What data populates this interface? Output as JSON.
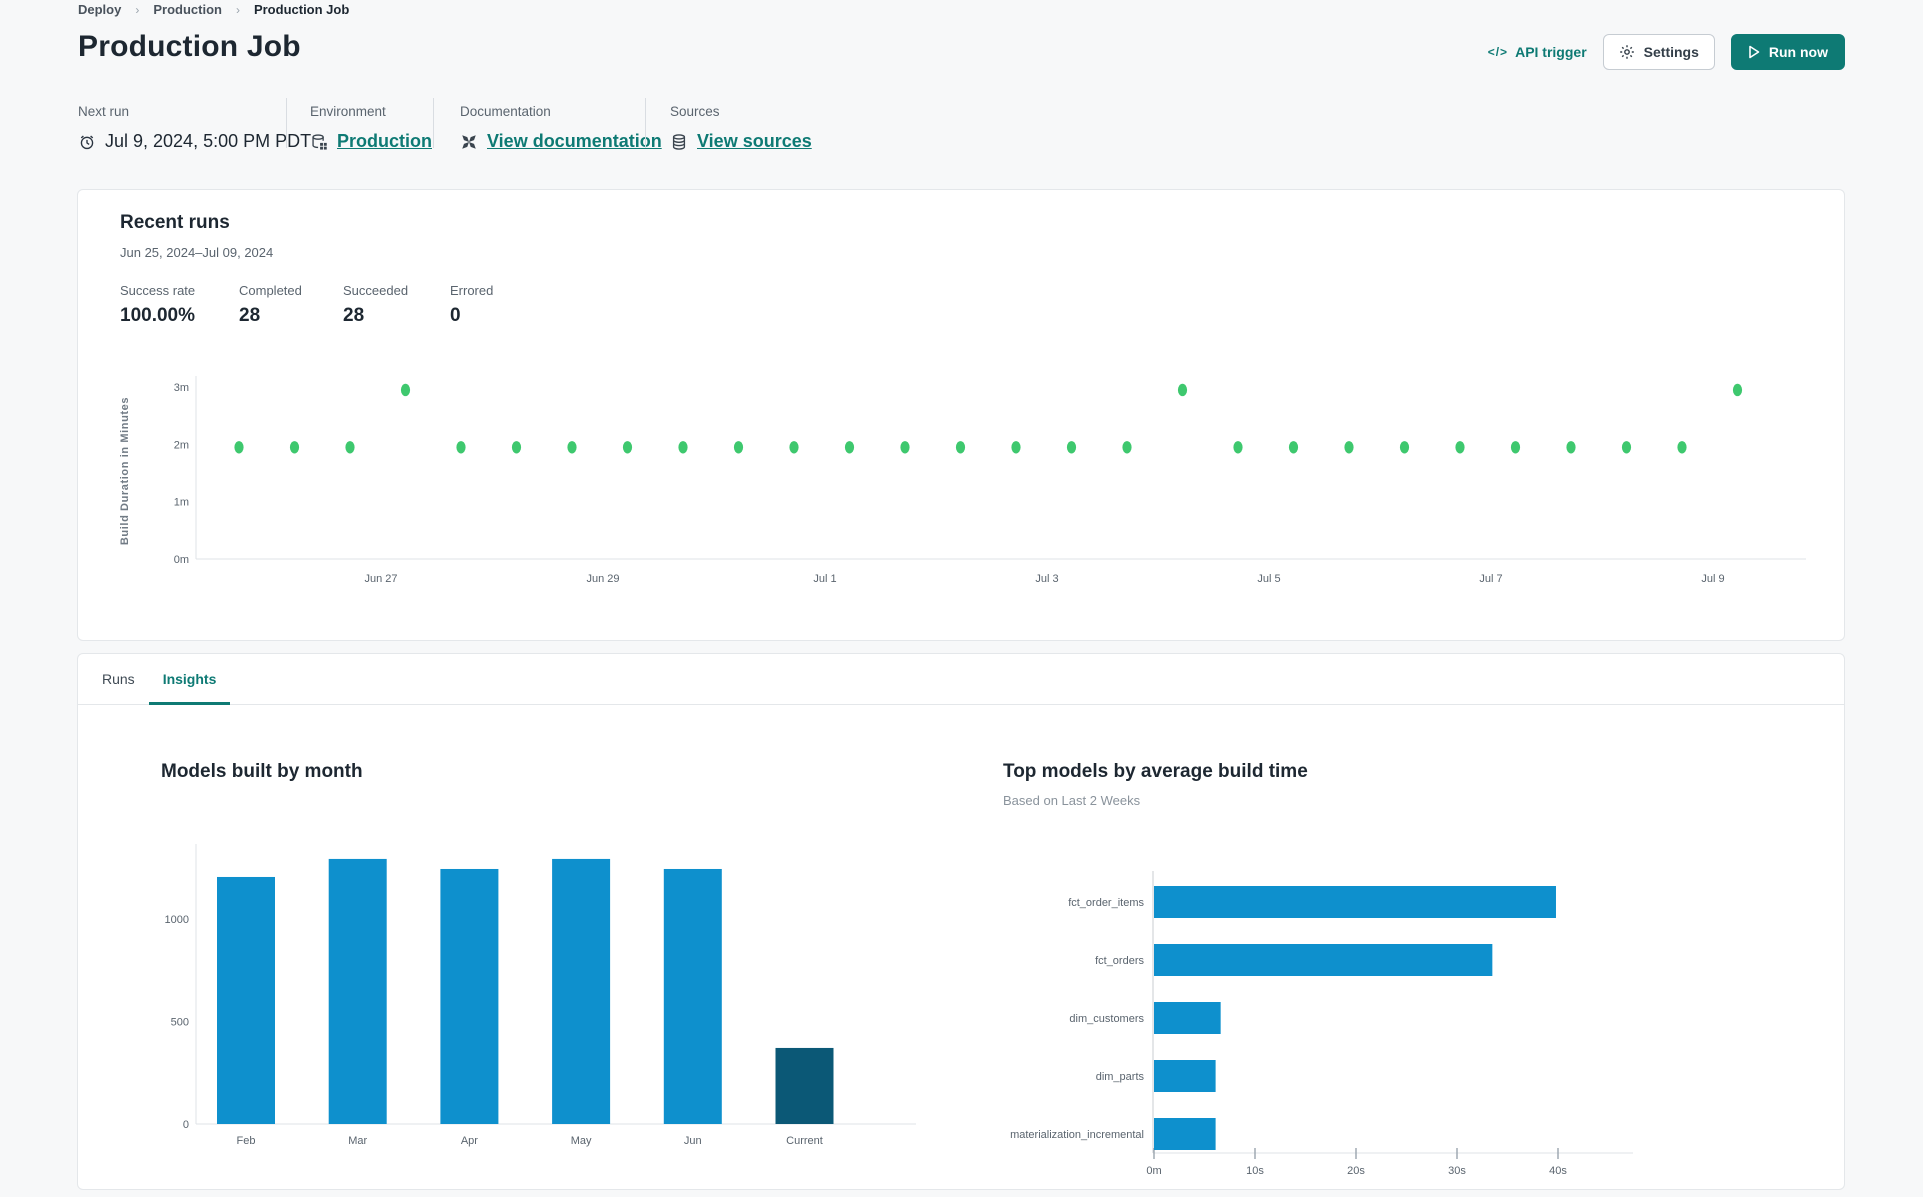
{
  "breadcrumb": {
    "items": [
      "Deploy",
      "Production",
      "Production Job"
    ]
  },
  "header": {
    "title": "Production Job",
    "api_trigger": {
      "label": "API trigger",
      "icon": "code-icon"
    },
    "settings": {
      "label": "Settings",
      "icon": "gear-icon"
    },
    "run_now": {
      "label": "Run now",
      "icon": "play-icon"
    }
  },
  "info_bar": {
    "next_run": {
      "label": "Next run",
      "value": "Jul 9, 2024, 5:00 PM PDT",
      "icon": "alarm-clock-icon"
    },
    "environment": {
      "label": "Environment",
      "value": "Production",
      "icon": "environment-database-icon"
    },
    "documentation": {
      "label": "Documentation",
      "value": "View documentation",
      "icon": "dbt-docs-icon"
    },
    "sources": {
      "label": "Sources",
      "value": "View sources",
      "icon": "sources-database-icon"
    }
  },
  "recent_runs": {
    "title": "Recent runs",
    "date_range": "Jun 25, 2024–Jul 09, 2024",
    "stats": [
      {
        "label": "Success rate",
        "value": "100.00%"
      },
      {
        "label": "Completed",
        "value": "28"
      },
      {
        "label": "Succeeded",
        "value": "28"
      },
      {
        "label": "Errored",
        "value": "0"
      }
    ]
  },
  "tabs": [
    {
      "label": "Runs",
      "active": false
    },
    {
      "label": "Insights",
      "active": true
    }
  ],
  "colors": {
    "teal_accent": "#0e7a74",
    "bar_blue": "#0e90cd",
    "bar_navy": "#0b5876",
    "dot_green": "#3ec86e",
    "axis_text": "#5a646e",
    "axis_line": "#dfe3e7"
  },
  "chart_data": [
    {
      "id": "build-duration-scatter",
      "type": "scatter",
      "ylabel": "Build Duration in Minutes",
      "yticks": [
        "0m",
        "1m",
        "2m",
        "3m"
      ],
      "ylim": [
        0,
        3.3
      ],
      "xticks": [
        "Jun 27",
        "Jun 29",
        "Jul 1",
        "Jul 3",
        "Jul 5",
        "Jul 7",
        "Jul 9"
      ],
      "point_color": "#3ec86e",
      "values_minutes": [
        1.95,
        1.95,
        1.95,
        2.95,
        1.95,
        1.95,
        1.95,
        1.95,
        1.95,
        1.95,
        1.95,
        1.95,
        1.95,
        1.95,
        1.95,
        1.95,
        1.95,
        2.95,
        1.95,
        1.95,
        1.95,
        1.95,
        1.95,
        1.95,
        1.95,
        1.95,
        1.95,
        2.95
      ]
    },
    {
      "id": "models-built-by-month",
      "type": "bar",
      "title": "Models built by month",
      "categories": [
        "Feb",
        "Mar",
        "Apr",
        "May",
        "Jun",
        "Current"
      ],
      "values": [
        1205,
        1293,
        1244,
        1293,
        1244,
        371
      ],
      "yticks": [
        0,
        500,
        1000
      ],
      "ylim": [
        0,
        1400
      ],
      "bar_color": "#0e90cd",
      "highlight_index": 5,
      "highlight_color": "#0b5876"
    },
    {
      "id": "top-models-by-build-time",
      "type": "horizontal_bar",
      "title": "Top models by average build time",
      "subtitle": "Based on Last 2 Weeks",
      "categories": [
        "fct_order_items",
        "fct_orders",
        "dim_customers",
        "dim_parts",
        "materialization_incremental"
      ],
      "values_seconds": [
        39.8,
        33.5,
        6.6,
        6.1,
        6.1
      ],
      "xticks": [
        "0m",
        "10s",
        "20s",
        "30s",
        "40s"
      ],
      "xlim": [
        0,
        47
      ],
      "bar_color": "#0e90cd"
    }
  ]
}
